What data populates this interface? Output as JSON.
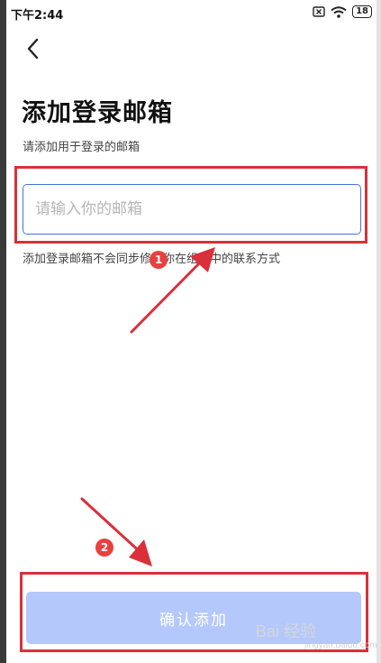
{
  "status_bar": {
    "time": "下午2:44",
    "battery": "18"
  },
  "header": {
    "back_label": "<"
  },
  "page": {
    "title": "添加登录邮箱",
    "subtitle": "请添加用于登录的邮箱",
    "email_input": {
      "value": "",
      "placeholder": "请输入你的邮箱"
    },
    "hint": "添加登录邮箱不会同步修改你在组织中的联系方式"
  },
  "footer": {
    "confirm_label": "确认添加"
  },
  "annotations": {
    "step1": "1",
    "step2": "2"
  },
  "watermark": {
    "text": "Bai 经验",
    "sub": "jingyan.baidu.com"
  },
  "colors": {
    "accent": "#3f76e0",
    "button_disabled": "#b4c8fb",
    "annotation_red": "#d9303a"
  }
}
